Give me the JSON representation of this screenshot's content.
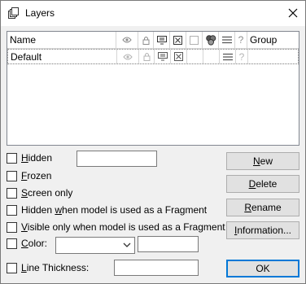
{
  "window": {
    "title": "Layers"
  },
  "grid": {
    "columns": [
      {
        "key": "name",
        "label": "Name"
      },
      {
        "key": "visible",
        "icon": "eye-arrows-icon"
      },
      {
        "key": "lock",
        "icon": "lock-icon"
      },
      {
        "key": "print",
        "icon": "monitor-icon"
      },
      {
        "key": "xbox",
        "icon": "x-box-icon"
      },
      {
        "key": "blank",
        "icon": "blank-square-icon"
      },
      {
        "key": "color",
        "icon": "color-circles-icon"
      },
      {
        "key": "lines",
        "icon": "lines-icon"
      },
      {
        "key": "question",
        "label": "?"
      },
      {
        "key": "group",
        "label": "Group"
      }
    ],
    "rows": [
      {
        "name": "Default",
        "question": "?"
      }
    ]
  },
  "options": {
    "hidden": {
      "label_pre": "",
      "label_u": "H",
      "label_post": "idden"
    },
    "frozen": {
      "label_pre": "",
      "label_u": "F",
      "label_post": "rozen"
    },
    "screen_only": {
      "label_pre": "",
      "label_u": "S",
      "label_post": "creen only"
    },
    "hidden_fragment": {
      "label_pre": "Hidden ",
      "label_u": "w",
      "label_post": "hen model is used as a Fragment"
    },
    "visible_fragment": {
      "label_pre": "",
      "label_u": "V",
      "label_post": "isible only when model is used as a Fragment"
    },
    "color": {
      "label_pre": "",
      "label_u": "C",
      "label_post": "olor:"
    },
    "line_thickness": {
      "label_pre": "",
      "label_u": "L",
      "label_post": "ine Thickness:"
    }
  },
  "buttons": {
    "new": {
      "label_pre": "",
      "label_u": "N",
      "label_post": "ew"
    },
    "delete": {
      "label_pre": "",
      "label_u": "D",
      "label_post": "elete"
    },
    "rename": {
      "label_pre": "",
      "label_u": "R",
      "label_post": "ename"
    },
    "information": {
      "label_pre": "",
      "label_u": "I",
      "label_post": "nformation..."
    },
    "ok": {
      "label": "OK"
    }
  },
  "colors": {
    "accent": "#0078d7",
    "icon_gray": "#8c8c8c"
  }
}
